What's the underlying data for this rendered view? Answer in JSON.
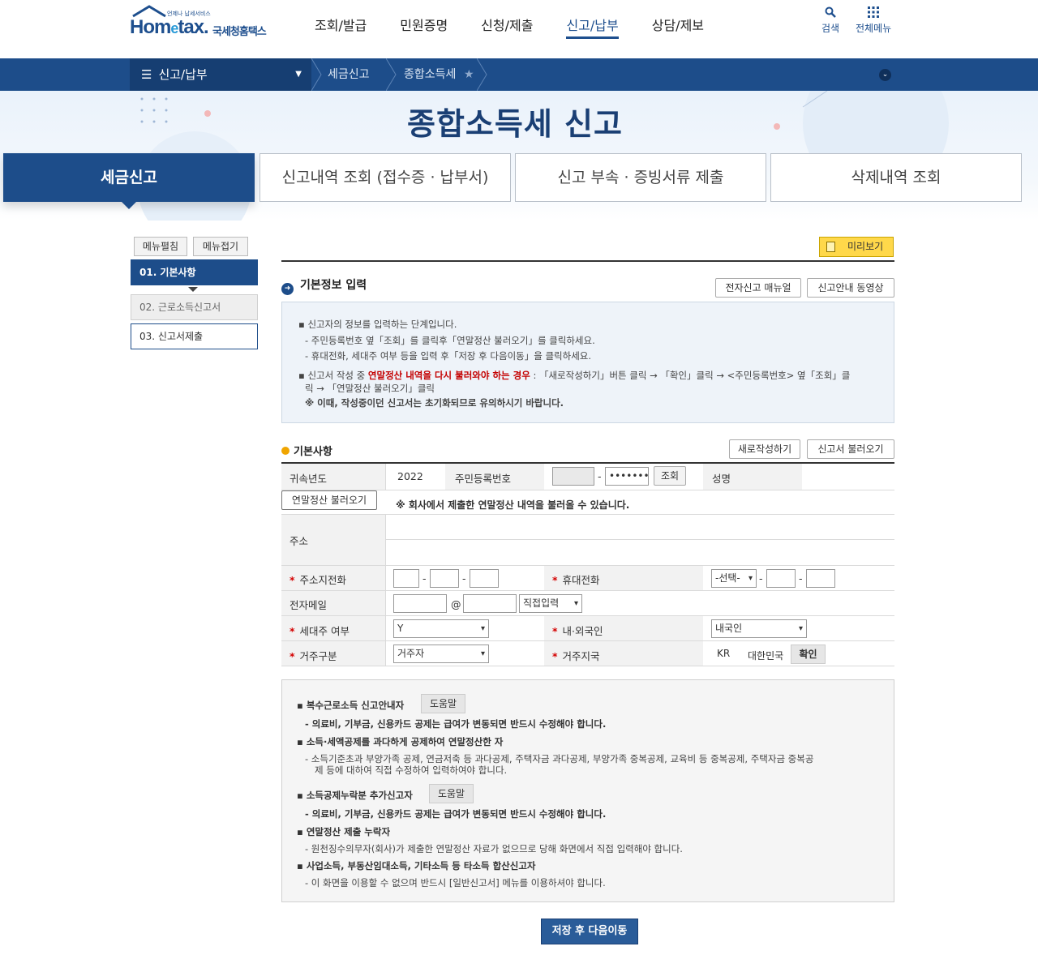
{
  "header": {
    "logo_tag": "언제나 납세서비스",
    "logo_main_a": "Hom",
    "logo_main_e": "e",
    "logo_main_b": "tax.",
    "logo_sub": "국세청홈택스",
    "nav": [
      "조회/발급",
      "민원증명",
      "신청/제출",
      "신고/납부",
      "상담/제보"
    ],
    "search_label": "검색",
    "allmenu_label": "전체메뉴"
  },
  "breadcrumb": {
    "main": "신고/납부",
    "items": [
      "세금신고",
      "종합소득세"
    ]
  },
  "hero": {
    "title": "종합소득세 신고"
  },
  "tabs": [
    "세금신고",
    "신고내역 조회 (접수증 · 납부서)",
    "신고 부속 · 증빙서류 제출",
    "삭제내역 조회"
  ],
  "left_menu": {
    "expand": "메뉴펼침",
    "collapse": "메뉴접기",
    "items": [
      "01. 기본사항",
      "02. 근로소득신고서",
      "03. 신고서제출"
    ]
  },
  "content": {
    "preview": "미리보기",
    "section_title": "기본정보 입력",
    "manual_btn": "전자신고 매뉴얼",
    "video_btn": "신고안내 동영상",
    "info": {
      "l1": "신고자의 정보를 입력하는 단계입니다.",
      "l2": "- 주민등록번호 옆「조회」를 클릭후「연말정산 불러오기」를 클릭하세요.",
      "l3": "- 휴대전화, 세대주 여부 등을 입력 후「저장 후 다음이동」을 클릭하세요.",
      "l4a": "신고서 작성 중 ",
      "l4b": "연말정산 내역을 다시 불러와야 하는 경우",
      "l4c": " : 「새로작성하기」버튼 클릭 → 「확인」클릭 → <주민등록번호> 옆「조회」클",
      "l5": "릭 → 「연말정산 불러오기」클릭",
      "l6": "※ 이때, 작성중이던 신고서는 초기화되므로 유의하시기 바랍니다."
    },
    "sub_title": "기본사항",
    "new_btn": "새로작성하기",
    "load_btn": "신고서 불러오기"
  },
  "form": {
    "year_label": "귀속년도",
    "year_value": "2022",
    "rrn_label": "주민등록번호",
    "rrn_front": "",
    "rrn_dash": "-",
    "rrn_back": "•••••••",
    "lookup_btn": "조회",
    "name_label": "성명",
    "yearend_btn": "연말정산 불러오기",
    "yearend_notice": "※ 회사에서 제출한 연말정산 내역을 불러올 수 있습니다.",
    "address_label": "주소",
    "req_mark": "*",
    "home_phone_label": "주소지전화",
    "mobile_label": "휴대전화",
    "mobile_select": "-선택-",
    "email_label": "전자메일",
    "email_at": "@",
    "email_domain_select": "직접입력",
    "householder_label": "세대주 여부",
    "householder_value": "Y",
    "nationality_label": "내·외국인",
    "nationality_value": "내국인",
    "residence_label": "거주구분",
    "residence_value": "거주자",
    "residence_country_label": "거주지국",
    "country_code": "KR",
    "country_name": "대한민국",
    "confirm_btn": "확인"
  },
  "notice": {
    "h1": "복수근로소득 신고안내자",
    "help1": "도움말",
    "d1": "- 의료비, 기부금, 신용카드 공제는 급여가 변동되면 반드시 수정해야 합니다.",
    "h2": "소득·세액공제를 과다하게 공제하여 연말정산한 자",
    "d2a": "- 소득기준초과 부양가족 공제, 연금저축 등 과다공제, 주택자금 과다공제, 부양가족 중복공제, 교육비 등 중복공제, 주택자금 중복공",
    "d2b": "제 등에 대하여 직접 수정하여 입력하여야 합니다.",
    "h3": "소득공제누락분 추가신고자",
    "help3": "도움말",
    "d3": "- 의료비, 기부금, 신용카드 공제는 급여가 변동되면 반드시 수정해야 합니다.",
    "h4": "연말정산 제출 누락자",
    "d4": "- 원천징수의무자(회사)가 제출한 연말정산 자료가 없으므로 당해 화면에서 직접 입력해야 합니다.",
    "h5": "사업소득, 부동산임대소득, 기타소득 등 타소득 합산신고자",
    "d5": "- 이 화면을 이용할 수 없으며 반드시 [일반신고서] 메뉴를 이용하셔야 합니다."
  },
  "save_next": "저장 후 다음이동",
  "colors": {
    "primary": "#1d4d8a",
    "accent_yellow": "#ffd84a",
    "required": "#d40000"
  }
}
